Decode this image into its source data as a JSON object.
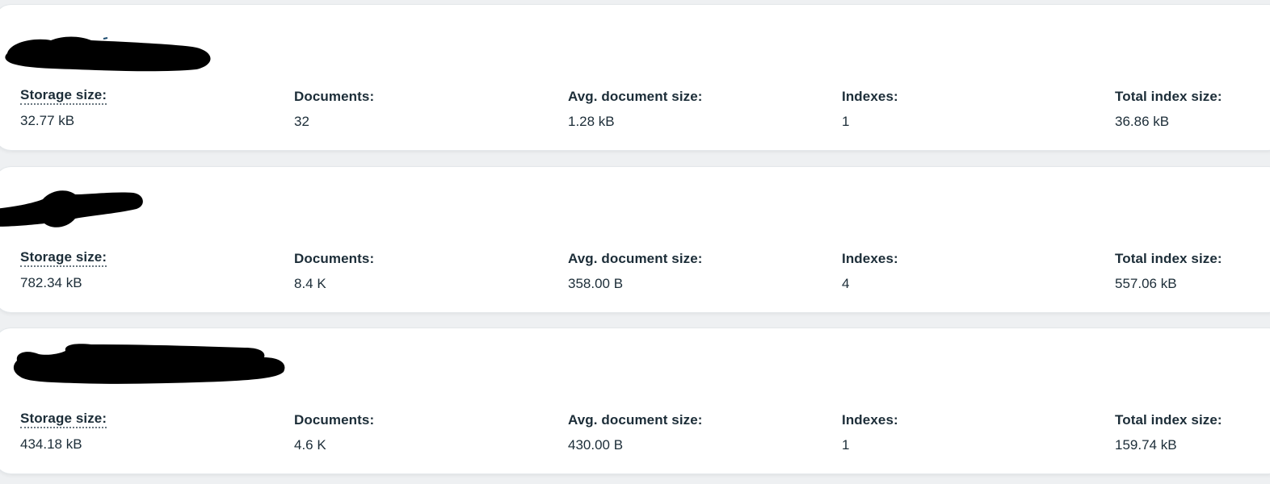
{
  "colors": {
    "card_background": "#ffffff",
    "page_background": "#eef0f2",
    "text": "#1c2d38",
    "redaction": "#000000"
  },
  "collections": [
    {
      "storage_size": {
        "label": "Storage size:",
        "value": "32.77 kB"
      },
      "documents": {
        "label": "Documents:",
        "value": "32"
      },
      "avg_document_size": {
        "label": "Avg. document size:",
        "value": "1.28 kB"
      },
      "indexes": {
        "label": "Indexes:",
        "value": "1"
      },
      "total_index_size": {
        "label": "Total index size:",
        "value": "36.86 kB"
      }
    },
    {
      "storage_size": {
        "label": "Storage size:",
        "value": "782.34 kB"
      },
      "documents": {
        "label": "Documents:",
        "value": "8.4 K"
      },
      "avg_document_size": {
        "label": "Avg. document size:",
        "value": "358.00 B"
      },
      "indexes": {
        "label": "Indexes:",
        "value": "4"
      },
      "total_index_size": {
        "label": "Total index size:",
        "value": "557.06 kB"
      }
    },
    {
      "storage_size": {
        "label": "Storage size:",
        "value": "434.18 kB"
      },
      "documents": {
        "label": "Documents:",
        "value": "4.6 K"
      },
      "avg_document_size": {
        "label": "Avg. document size:",
        "value": "430.00 B"
      },
      "indexes": {
        "label": "Indexes:",
        "value": "1"
      },
      "total_index_size": {
        "label": "Total index size:",
        "value": "159.74 kB"
      }
    }
  ]
}
